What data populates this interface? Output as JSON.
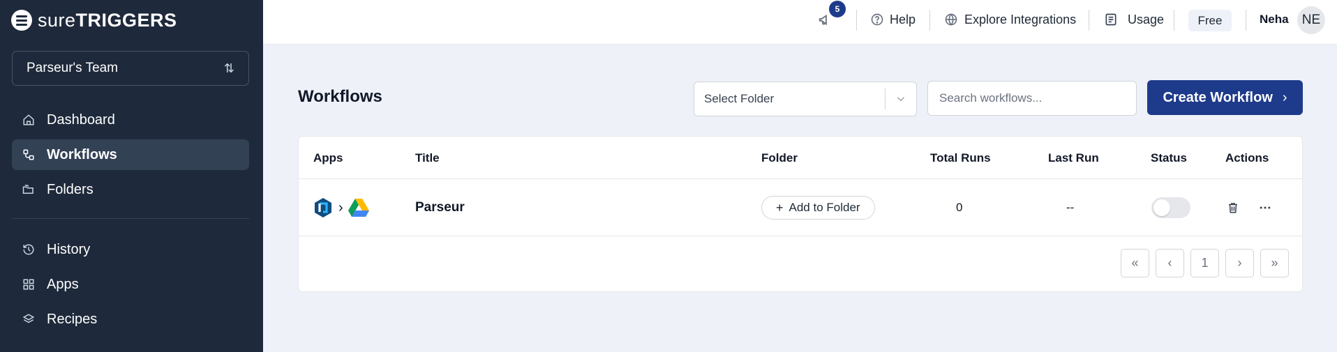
{
  "brand": {
    "logo_bold_prefix": "sure",
    "logo_suffix": "TRIGGERS"
  },
  "sidebar": {
    "team": "Parseur's Team",
    "nav_primary": [
      {
        "label": "Dashboard",
        "icon": "home-icon",
        "active": false
      },
      {
        "label": "Workflows",
        "icon": "workflow-icon",
        "active": true
      },
      {
        "label": "Folders",
        "icon": "folders-icon",
        "active": false
      }
    ],
    "nav_secondary": [
      {
        "label": "History",
        "icon": "history-icon",
        "active": false
      },
      {
        "label": "Apps",
        "icon": "apps-grid-icon",
        "active": false
      },
      {
        "label": "Recipes",
        "icon": "layers-icon",
        "active": false
      }
    ]
  },
  "header": {
    "notification_count": "5",
    "help": "Help",
    "explore": "Explore Integrations",
    "usage": "Usage",
    "plan": "Free",
    "user_name": "Neha",
    "avatar_initials": "NE"
  },
  "main": {
    "title": "Workflows",
    "select_folder": "Select Folder",
    "search_placeholder": "Search workflows...",
    "create_button": "Create Workflow",
    "table": {
      "columns": [
        "Apps",
        "Title",
        "Folder",
        "Total Runs",
        "Last Run",
        "Status",
        "Actions"
      ],
      "rows": [
        {
          "apps": [
            "parseur-logo-icon",
            "google-drive-icon"
          ],
          "title": "Parseur",
          "folder_action": "Add to Folder",
          "total_runs": "0",
          "last_run": "--",
          "status_on": false
        }
      ]
    },
    "pagination": {
      "current_page": "1"
    }
  },
  "colors": {
    "sidebar_bg": "#1e293b",
    "primary": "#1e3a8a",
    "page_bg": "#eef1f8"
  }
}
